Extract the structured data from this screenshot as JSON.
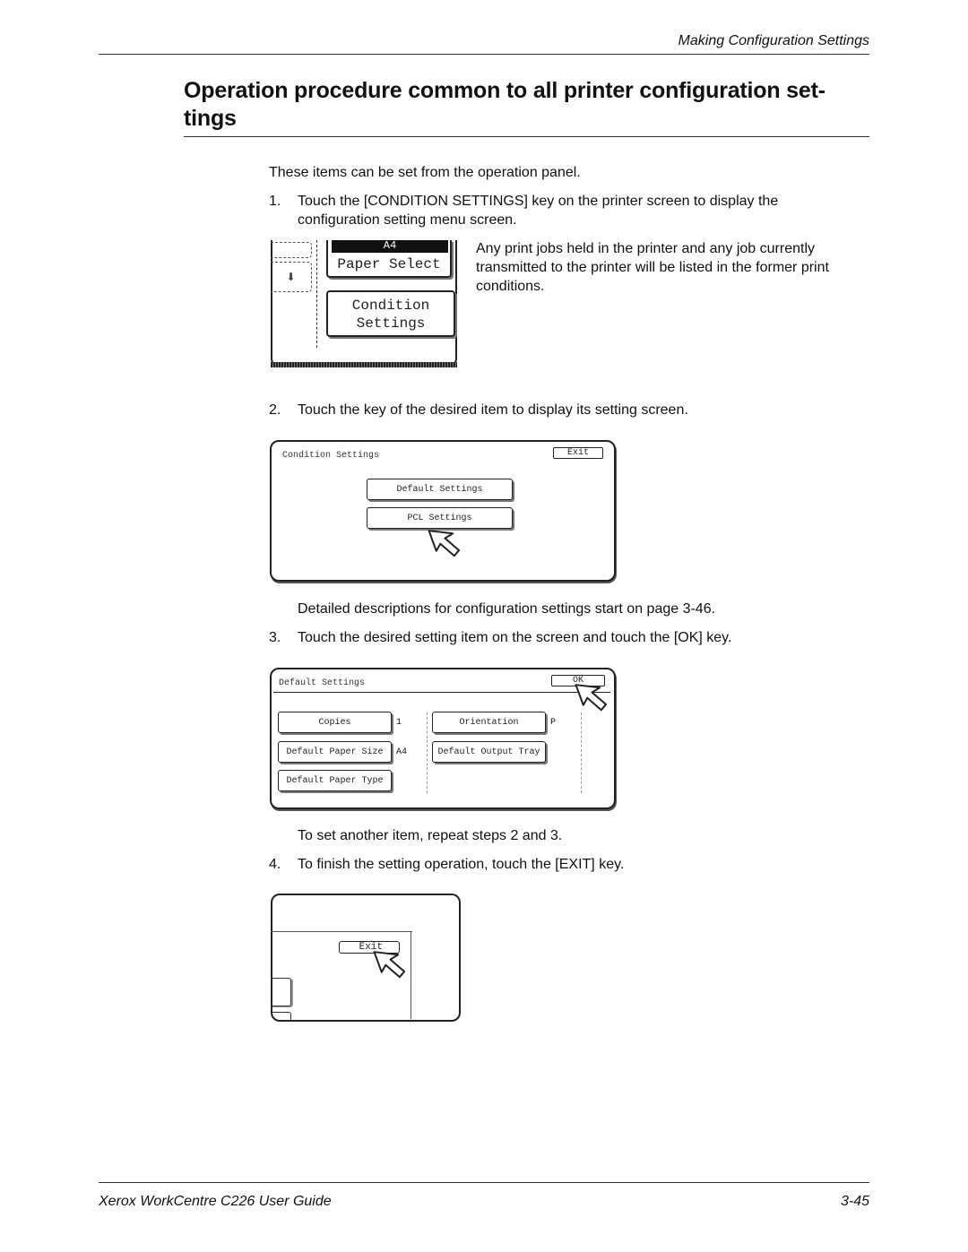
{
  "header": {
    "running_title": "Making Configuration Settings"
  },
  "section": {
    "title": "Operation procedure common to all printer configuration set-tings",
    "title_line1": "Operation procedure common to all printer configuration set-",
    "title_line2": "tings"
  },
  "intro": "These items can be set from the operation panel.",
  "steps": [
    {
      "number": "1.",
      "text_line1": "Touch the [CONDITION SETTINGS] key on the printer screen to display the",
      "text_line2": "configuration setting menu screen.",
      "note_line1": "Any print jobs held in the printer and any job currently",
      "note_line2": "transmitted to the printer will be listed in the former print",
      "note_line3": "conditions."
    },
    {
      "number": "2.",
      "text": "Touch the key of the desired item to display its setting screen.",
      "note": "Detailed descriptions for configuration settings start on page 3-46."
    },
    {
      "number": "3.",
      "text": "Touch the desired setting item on the screen and touch the [OK] key.",
      "note": "To set another item, repeat steps 2 and 3."
    },
    {
      "number": "4.",
      "text": "To finish the setting operation, touch the [EXIT] key."
    }
  ],
  "screen1": {
    "paper_value": "A4",
    "paper_select_label": "Paper Select",
    "condition_settings_line1": "Condition",
    "condition_settings_line2": "Settings"
  },
  "screen2": {
    "title": "Condition Settings",
    "exit_label": "Exit",
    "buttons": [
      "Default Settings",
      "PCL Settings"
    ]
  },
  "screen3": {
    "title": "Default Settings",
    "ok_label": "OK",
    "items": [
      {
        "label": "Copies",
        "value": "1"
      },
      {
        "label": "Default Paper Size",
        "value": "A4"
      },
      {
        "label": "Default Paper Type",
        "value": ""
      },
      {
        "label": "Orientation",
        "value": "P"
      },
      {
        "label": "Default Output Tray",
        "value": ""
      }
    ]
  },
  "screen4": {
    "exit_label": "Exit"
  },
  "footer": {
    "guide_title": "Xerox WorkCentre C226 User Guide",
    "page_number": "3-45"
  }
}
